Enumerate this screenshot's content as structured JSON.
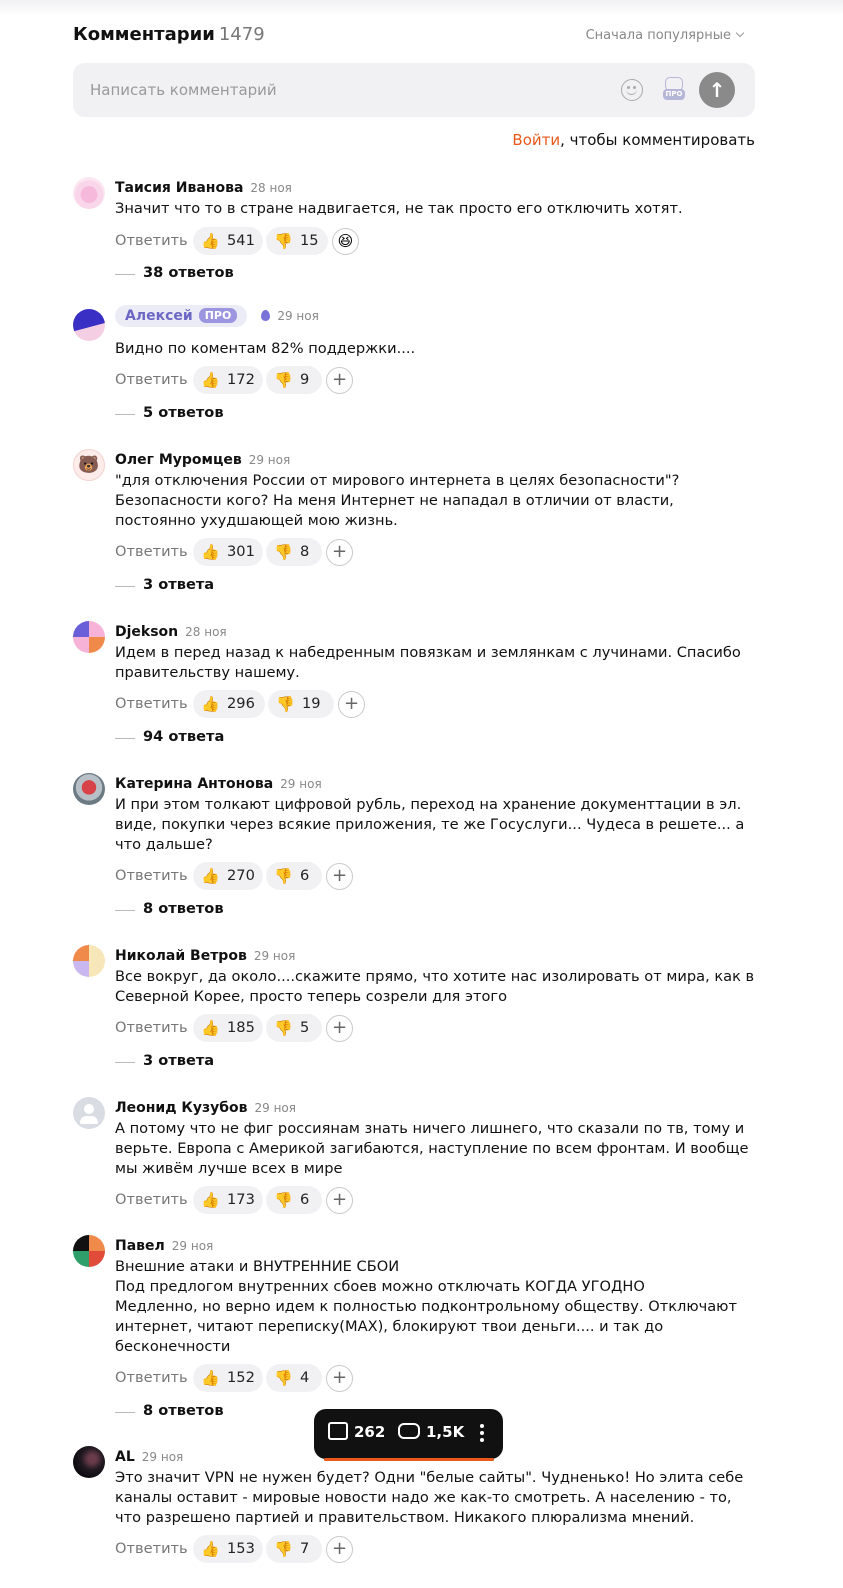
{
  "header": {
    "title": "Комментарии",
    "count": "1479",
    "sort_label": "Сначала популярные"
  },
  "composer": {
    "placeholder": "Написать комментарий",
    "pro_tag": "ПРО"
  },
  "login": {
    "link": "Войти",
    "rest": ", чтобы комментировать"
  },
  "labels": {
    "reply": "Ответить",
    "plus": "+"
  },
  "comments": [
    {
      "author": "Таисия Иванова",
      "date": "28 ноя",
      "text": "Значит что то в стране надвигается, не так просто его отключить хотят.",
      "likes": "541",
      "dislikes": "15",
      "replies": "38 ответов"
    },
    {
      "author": "Алексей",
      "badge": "ПРО",
      "date": "29 ноя",
      "text": "Видно по коментам 82% поддержки....",
      "likes": "172",
      "dislikes": "9",
      "replies": "5 ответов"
    },
    {
      "author": "Олег Муромцев",
      "date": "29 ноя",
      "text": "\"для отключения России от мирового интернета в целях безопасности\"? Безопасности кого? На меня Интернет не нападал в отличии от власти, постоянно ухудшающей мою жизнь.",
      "likes": "301",
      "dislikes": "8",
      "replies": "3 ответа"
    },
    {
      "author": "Djekson",
      "date": "28 ноя",
      "text": "Идем в перед назад к набедренным повязкам и землянкам с лучинами. Спасибо правительству нашему.",
      "likes": "296",
      "dislikes": "19",
      "replies": "94 ответа"
    },
    {
      "author": "Катерина Антонова",
      "date": "29 ноя",
      "text": "И при этом толкают цифровой рубль, переход на хранение документтации в эл. виде, покупки через всякие приложения, те же Госуслуги... Чудеса в решете... а что дальше?",
      "likes": "270",
      "dislikes": "6",
      "replies": "8 ответов"
    },
    {
      "author": "Николай Ветров",
      "date": "29 ноя",
      "text": "Все вокруг, да около....скажите прямо, что хотите нас изолировать от мира, как в Северной Корее, просто теперь созрели для этого",
      "likes": "185",
      "dislikes": "5",
      "replies": "3 ответа"
    },
    {
      "author": "Леонид Кузубов",
      "date": "29 ноя",
      "text": "А потому что не фиг россиянам знать ничего лишнего, что сказали по тв, тому и верьте. Европа с Америкой загибаются, наступление по всем фронтам. И вообще мы живём лучше всех в мире",
      "likes": "173",
      "dislikes": "6"
    },
    {
      "author": "Павел",
      "date": "29 ноя",
      "text_lines": [
        "Внешние атаки и ВНУТРЕННИЕ СБОИ",
        "Под предлогом внутренних сбоев можно отключать КОГДА УГОДНО",
        "Медленно, но верно идем к полностью подконтрольному обществу. Отключают интернет, читают переписку(MAX), блокируют твои деньги.... и так до бесконечности"
      ],
      "likes": "152",
      "dislikes": "4",
      "replies": "8 ответов"
    },
    {
      "author": "AL",
      "date": "29 ноя",
      "text": "Это значит VPN не нужен будет? Одни \"белые сайты\". Чудненько! Но элита себе каналы оставит - мировые новости надо же как-то смотреть. А населению - то, что разрешено партией и правительством. Никакого плюрализма мнений.",
      "likes": "153",
      "dislikes": "7"
    }
  ],
  "float_bar": {
    "likes": "262",
    "comments": "1,5K"
  }
}
